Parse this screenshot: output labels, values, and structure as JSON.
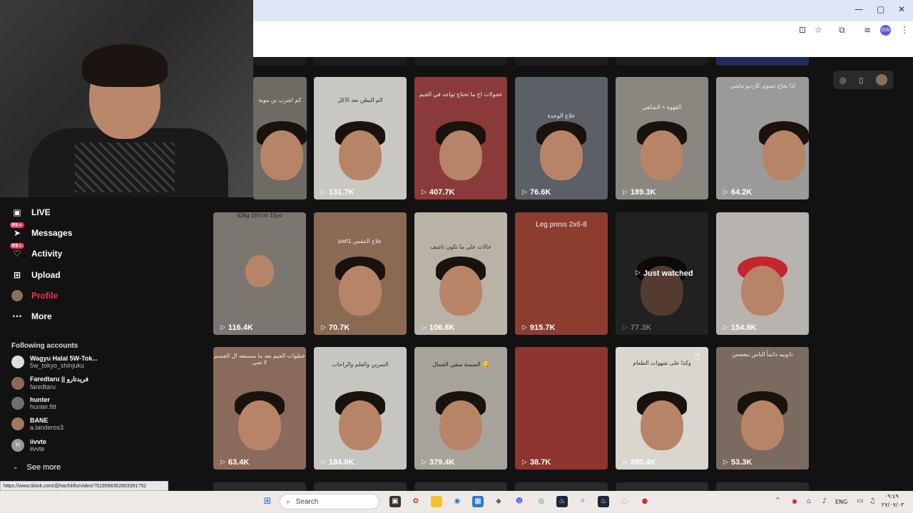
{
  "browser": {
    "window_controls": [
      "—",
      "▢",
      "✕"
    ],
    "profile_initials": "GW"
  },
  "sidebar": {
    "items": [
      {
        "label": "LIVE",
        "icon": "live-icon"
      },
      {
        "label": "Messages",
        "icon": "messages-icon",
        "badge": "99+"
      },
      {
        "label": "Activity",
        "icon": "activity-icon",
        "badge": "99+"
      },
      {
        "label": "Upload",
        "icon": "upload-icon"
      },
      {
        "label": "Profile",
        "icon": "profile-icon",
        "active": true
      },
      {
        "label": "More",
        "icon": "more-icon"
      }
    ],
    "following_title": "Following accounts",
    "following": [
      {
        "name": "Wagyu Halal 5W-Tok...",
        "handle": "5w_tokyo_shinjuku"
      },
      {
        "name": "Faredtaru || فريدتارو",
        "handle": "faredtaru"
      },
      {
        "name": "hunter",
        "handle": "hunter.fitt"
      },
      {
        "name": "BANE",
        "handle": "a.landeros3"
      },
      {
        "name": "iivvte",
        "handle": "iivvte",
        "initial": "H"
      }
    ],
    "see_more": "See more"
  },
  "status_url": "https://www.tiktok.com/@hachilifts/video/7519598362803391752",
  "grid": {
    "rows": [
      [
        {
          "caption": "كم اشرب بن موية",
          "views": ""
        },
        {
          "caption": "الم البطن بعد الاكل",
          "views": "131.7K"
        },
        {
          "caption": "عجولات اخ ما تحتاج تواجد في الجيم",
          "views": "407.7K"
        },
        {
          "caption": "علاج الوحدة",
          "views": "76.6K"
        },
        {
          "caption": "القهوة > الشاهي",
          "views": "189.3K"
        },
        {
          "caption": "اذا بحاج تسوي كارديو ماشي",
          "views": "64.2K"
        }
      ],
      [
        {
          "caption": "62kg 197cm 15yo",
          "views": "116.4K"
        },
        {
          "caption": "part1 علاج التنفس",
          "views": "70.7K"
        },
        {
          "caption": "حالات علي ما تكون تاشف",
          "views": "106.8K"
        },
        {
          "caption": "Leg press 2x6-8",
          "views": "915.7K"
        },
        {
          "caption": "",
          "views": "77.3K",
          "watched": "Just watched"
        },
        {
          "caption": "",
          "views": "154.9K"
        }
      ],
      [
        {
          "caption": "خطوات الجيم بعد ما سستعه ال الجسم لا شي",
          "views": "63.4K"
        },
        {
          "caption": "التمرين والعلم والراحات",
          "views": "184.8K"
        },
        {
          "caption": "السمنة منقي الجمال 😋",
          "views": "379.4K"
        },
        {
          "caption": "",
          "views": "38.7K"
        },
        {
          "caption": "وكذا على شهوات الطعام",
          "views": "290.4K"
        },
        {
          "caption": "ناتوبيه دائماً الناس نبغضعن",
          "views": "53.3K"
        }
      ]
    ]
  },
  "taskbar": {
    "search_placeholder": "Search",
    "lang": "ENG",
    "time": "٠٩:٤٩",
    "date": "٢٧/٠٧/٠٣"
  },
  "colors": {
    "accent": "#fe2c55",
    "background": "#121212"
  }
}
